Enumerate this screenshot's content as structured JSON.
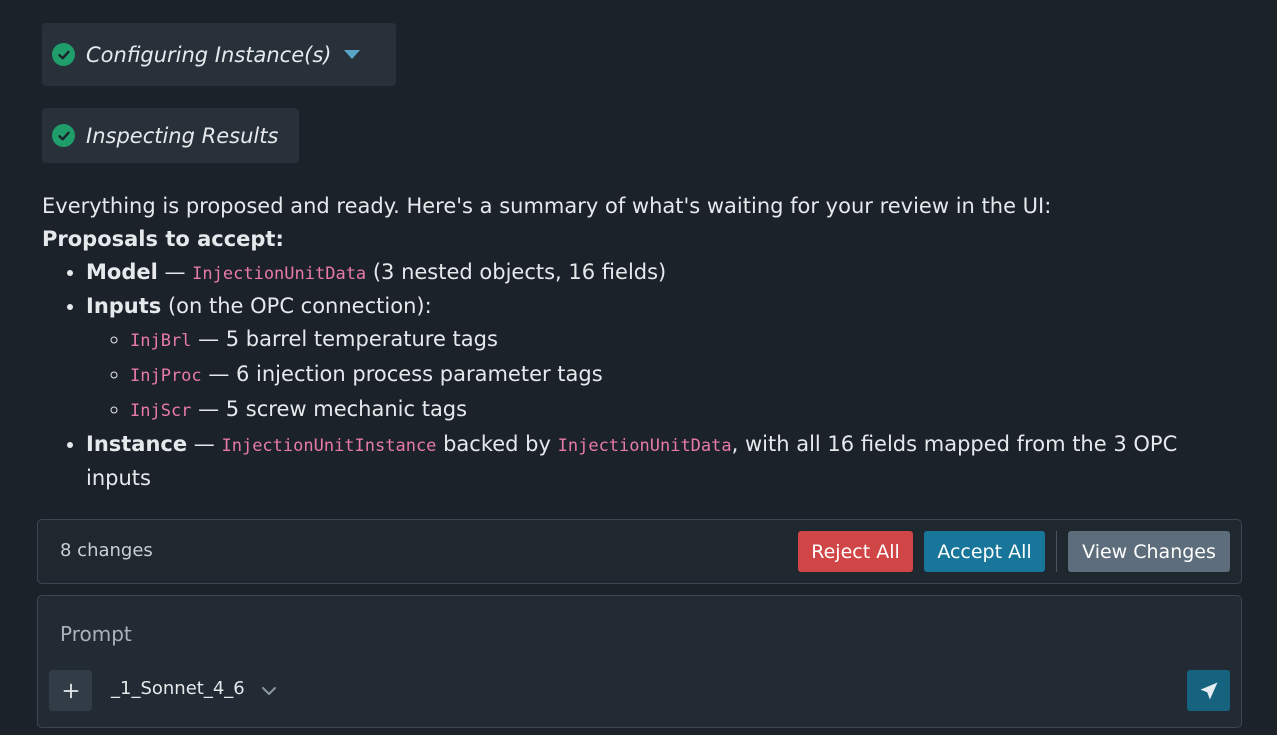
{
  "steps": [
    {
      "label": "Configuring Instance(s)",
      "status": "done",
      "expandable": true
    },
    {
      "label": "Inspecting Results",
      "status": "done",
      "expandable": false
    }
  ],
  "message": {
    "intro": "Everything is proposed and ready. Here's a summary of what's waiting for your review in the UI:",
    "heading": "Proposals to accept:",
    "model": {
      "label": "Model",
      "sep": " — ",
      "code": "InjectionUnitData",
      "rest": " (3 nested objects, 16 fields)"
    },
    "inputs": {
      "label": "Inputs",
      "rest": " (on the OPC connection):",
      "items": [
        {
          "code": "InjBrl",
          "text": " — 5 barrel temperature tags"
        },
        {
          "code": "InjProc",
          "text": " — 6 injection process parameter tags"
        },
        {
          "code": "InjScr",
          "text": " — 5 screw mechanic tags"
        }
      ]
    },
    "instance": {
      "label": "Instance",
      "sep": " — ",
      "code": "InjectionUnitInstance",
      "mid": " backed by ",
      "code2": "InjectionUnitData",
      "rest": ", with all 16 fields mapped from the 3 OPC inputs"
    }
  },
  "changes": {
    "count_label": "8 changes",
    "reject_label": "Reject All",
    "accept_label": "Accept All",
    "view_label": "View Changes"
  },
  "prompt": {
    "placeholder": "Prompt",
    "model": "_1_Sonnet_4_6"
  },
  "colors": {
    "background": "#1b222a",
    "success": "#1f9e6b",
    "reject": "#d04545",
    "accept": "#17769a",
    "view": "#5d6d7b",
    "code": "#e87aa8",
    "send": "#16637f"
  },
  "icons": {
    "step_status": "check-circle-icon",
    "step_toggle": "caret-down-icon",
    "add": "plus-icon",
    "model_toggle": "chevron-down-icon",
    "send": "paper-plane-icon"
  }
}
